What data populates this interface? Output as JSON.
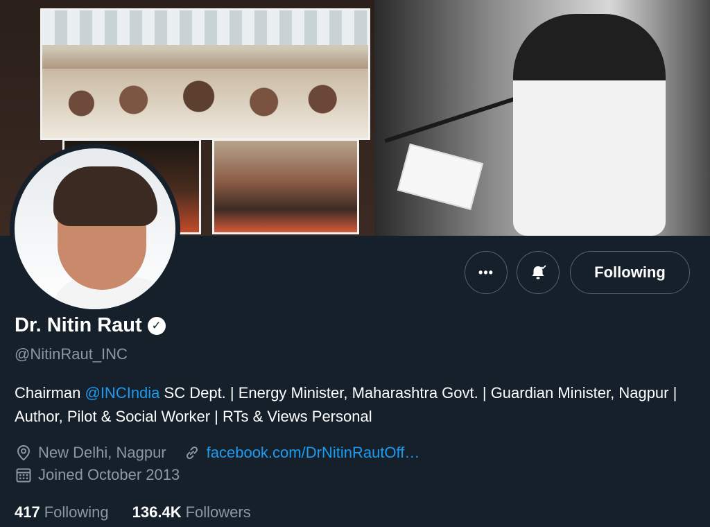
{
  "profile": {
    "name": "Dr. Nitin Raut",
    "handle": "@NitinRaut_INC",
    "bio_pre": "Chairman ",
    "bio_mention": "@INCIndia",
    "bio_post": " SC Dept. | Energy Minister, Maharashtra Govt. | Guardian Minister, Nagpur | Author, Pilot & Social Worker | RTs & Views Personal",
    "location": "New Delhi, Nagpur",
    "website": "facebook.com/DrNitinRautOff…",
    "joined": "Joined October 2013"
  },
  "stats": {
    "following_count": "417",
    "following_label": "Following",
    "followers_count": "136.4K",
    "followers_label": "Followers"
  },
  "actions": {
    "more_label": "•••",
    "following_button": "Following"
  },
  "icons": {
    "more": "more-icon",
    "bell": "notification-bell-icon",
    "verified": "verified-badge-icon",
    "location": "location-pin-icon",
    "link": "link-icon",
    "calendar": "calendar-icon"
  },
  "colors": {
    "background": "#15202b",
    "accent": "#1d9bf0",
    "secondary_text": "#8b98a5",
    "border": "#536471"
  }
}
